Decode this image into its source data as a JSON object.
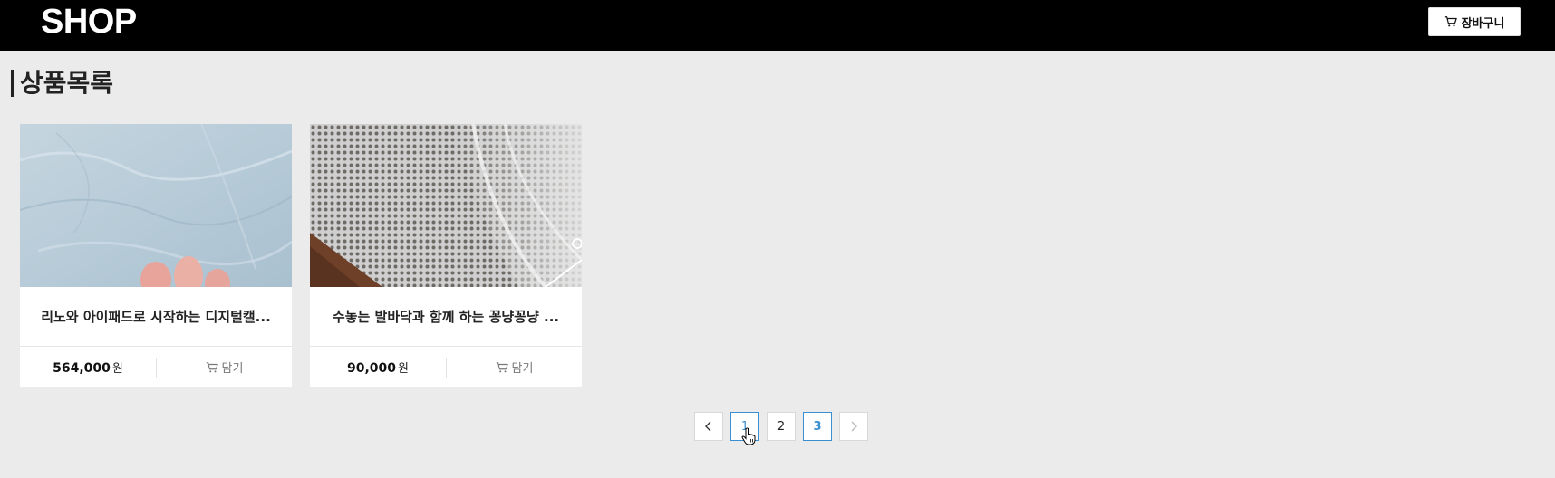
{
  "header": {
    "logo": "SHOP",
    "cart_button_label": "장바구니",
    "cart_icon": "cart-icon"
  },
  "page": {
    "title": "상품목록"
  },
  "products": [
    {
      "title": "리노와 아이패드로 시작하는 디지털캘...",
      "price": "564,000",
      "currency": "원",
      "add_label": "담기",
      "image": "crinkled light-blue fabric with fingers"
    },
    {
      "title": "수놓는 발바닥과 함께 하는 꽁냥꽁냥 ...",
      "price": "90,000",
      "currency": "원",
      "add_label": "담기",
      "image": "white mesh fabric on wooden surface"
    }
  ],
  "pagination": {
    "prev_icon": "chevron-left-icon",
    "next_icon": "chevron-right-icon",
    "pages": [
      "1",
      "2",
      "3"
    ],
    "current_page": "1",
    "highlighted_page": "3"
  },
  "colors": {
    "header_bg": "#000000",
    "page_bg": "#ebebeb",
    "accent": "#3a8fd0"
  }
}
